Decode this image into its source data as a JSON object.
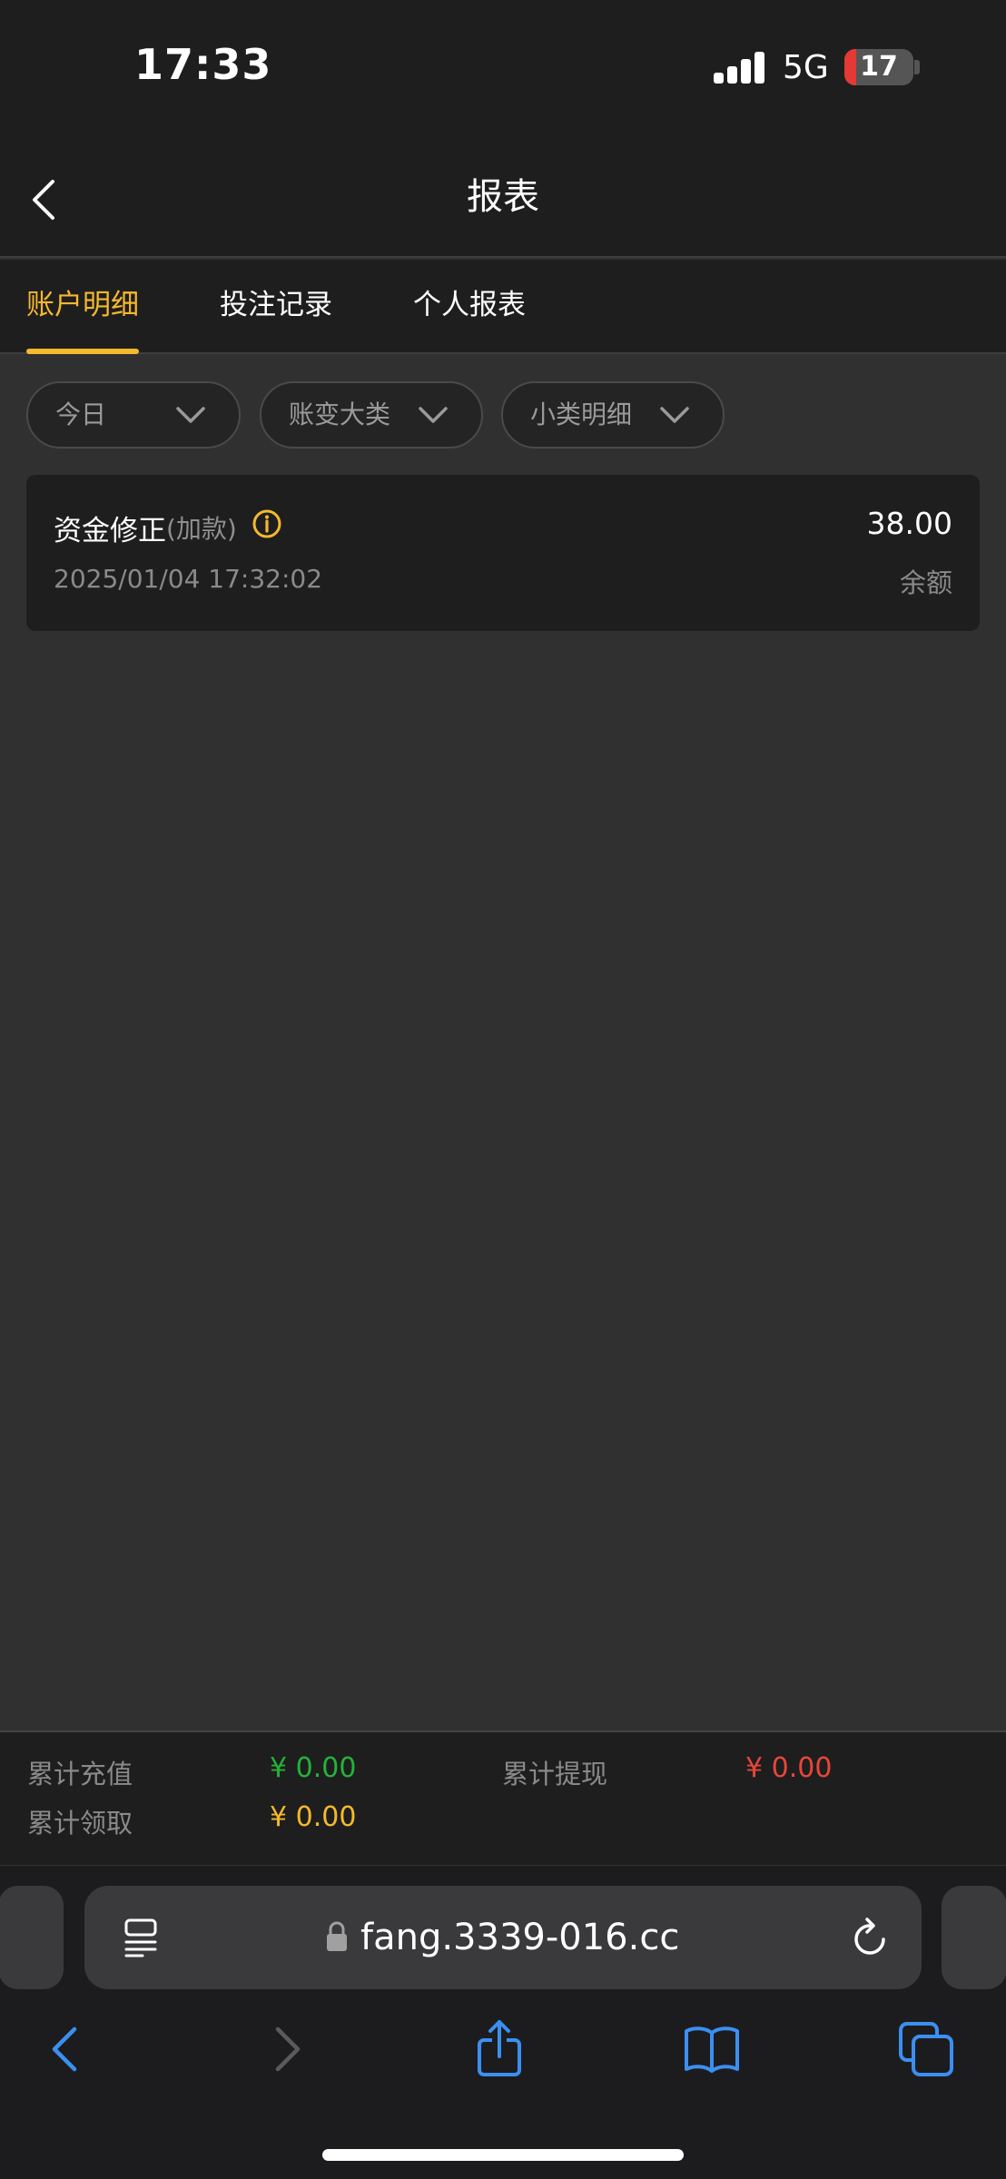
{
  "status_bar": {
    "time": "17:33",
    "network": "5G",
    "battery": "17",
    "battery_level": 0.17
  },
  "nav": {
    "title": "报表",
    "back_icon": "chevron-left-icon"
  },
  "tabs": [
    {
      "label": "账户明细",
      "active": true
    },
    {
      "label": "投注记录",
      "active": false
    },
    {
      "label": "个人报表",
      "active": false
    }
  ],
  "filters": [
    {
      "label": "今日",
      "icon": "chevron-down-icon"
    },
    {
      "label": "账变大类",
      "icon": "chevron-down-icon"
    },
    {
      "label": "小类明细",
      "icon": "chevron-down-icon"
    }
  ],
  "records": [
    {
      "title": "资金修正",
      "subtitle": "(加款)",
      "datetime": "2025/01/04 17:32:02",
      "amount": "38.00",
      "balance_label": "余额",
      "info_icon": "info-circle-icon"
    }
  ],
  "summary": {
    "recharge_label": "累计充值",
    "recharge_value": "¥ 0.00",
    "withdraw_label": "累计提现",
    "withdraw_value": "¥ 0.00",
    "claim_label": "累计领取",
    "claim_value": "¥ 0.00"
  },
  "browser": {
    "url": "fang.3339-016.cc",
    "icons": [
      "reader-icon",
      "lock-icon",
      "reload-icon",
      "back-icon",
      "forward-icon",
      "share-icon",
      "bookmarks-icon",
      "tabs-icon"
    ]
  },
  "colors": {
    "accent": "#f5b82e",
    "recharge": "#22b33a",
    "withdraw": "#e8463a",
    "claim": "#f5b82e",
    "safari_blue": "#3b8ff0"
  }
}
